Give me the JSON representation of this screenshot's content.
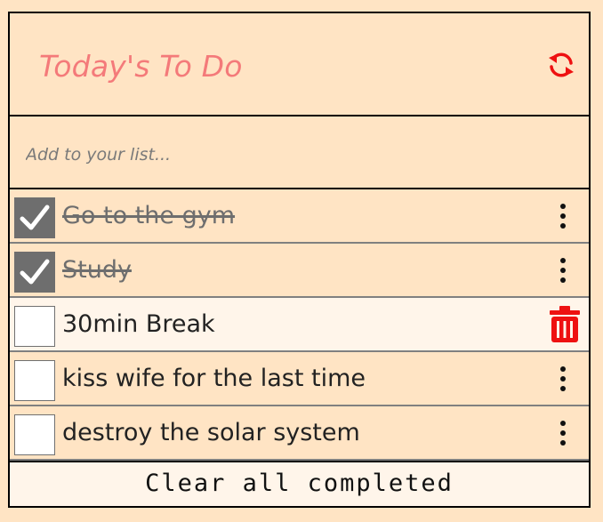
{
  "header": {
    "title": "Today's To Do",
    "refresh_icon": "refresh-icon"
  },
  "input": {
    "placeholder": "Add to your list...",
    "value": ""
  },
  "todos": [
    {
      "text": "Go to the gym",
      "completed": true
    },
    {
      "text": "Study",
      "completed": true
    },
    {
      "text": "30min Break",
      "completed": false,
      "hovered": true
    },
    {
      "text": "kiss wife for the last time",
      "completed": false
    },
    {
      "text": "destroy the solar system",
      "completed": false
    }
  ],
  "footer": {
    "clear_label": "Clear all completed"
  },
  "colors": {
    "background": "#ffe4c4",
    "title": "#f47a7a",
    "accent_red": "#ee1111",
    "checked_box": "#6e6e6e"
  }
}
